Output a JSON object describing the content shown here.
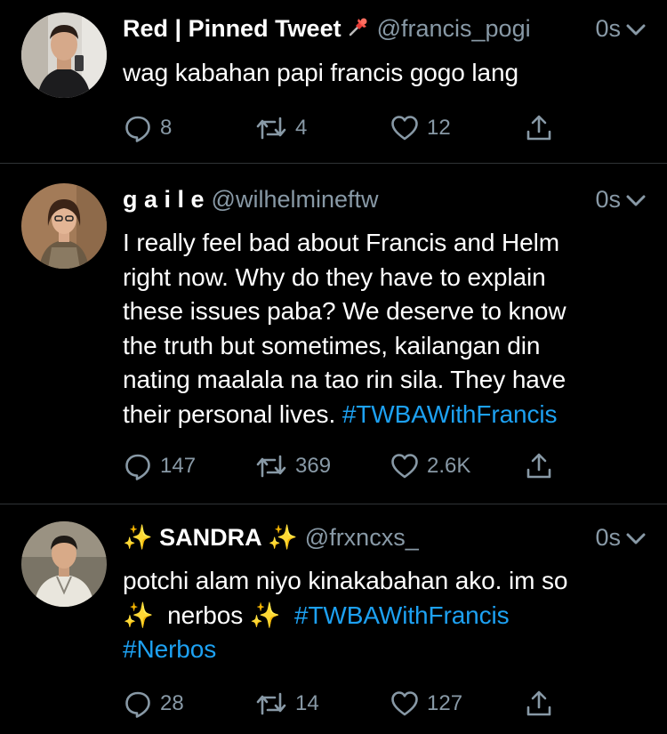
{
  "tweets": [
    {
      "name": "Red | Pinned Tweet",
      "pin_icon": "pushpin-emoji",
      "handle": "@francis_pogi",
      "time": "0s",
      "text_lines": [
        "wag kabahan papi francis gogo lang"
      ],
      "replies": "8",
      "retweets": "4",
      "likes": "12"
    },
    {
      "name": "g a i l e",
      "handle": "@wilhelmineftw",
      "time": "0s",
      "text_lines": [
        "I really feel bad about Francis and Helm",
        "right now. Why do they have to explain",
        "these issues paba? We deserve to know",
        "the truth but sometimes, kailangan din",
        "nating maalala na tao rin sila. They have",
        "their personal lives."
      ],
      "hashtag": "#TWBAWithFrancis",
      "replies": "147",
      "retweets": "369",
      "likes": "2.6K"
    },
    {
      "name_sparkle_left": "✨",
      "name": "SANDRA",
      "name_sparkle_right": "✨",
      "handle": "@frxncxs_",
      "time": "0s",
      "text_line1": "potchi alam niyo kinakabahan ako. im so",
      "line2_sparkle_left": "✨",
      "line2_word": "nerbos",
      "line2_sparkle_right": "✨",
      "hashtag1": "#TWBAWithFrancis",
      "hashtag2": "#Nerbos",
      "replies": "28",
      "retweets": "14",
      "likes": "127"
    }
  ],
  "colors": {
    "background": "#000000",
    "text": "#ffffff",
    "secondary": "#8899a6",
    "link": "#1da1f2",
    "divider": "#2f3336"
  }
}
